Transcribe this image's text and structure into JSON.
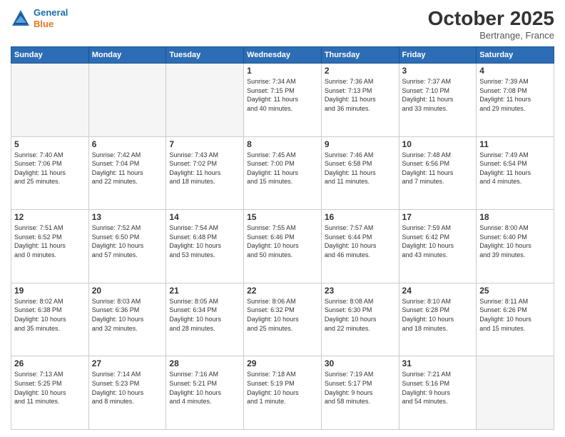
{
  "header": {
    "logo_line1": "General",
    "logo_line2": "Blue",
    "month": "October 2025",
    "location": "Bertrange, France"
  },
  "weekdays": [
    "Sunday",
    "Monday",
    "Tuesday",
    "Wednesday",
    "Thursday",
    "Friday",
    "Saturday"
  ],
  "weeks": [
    [
      {
        "day": "",
        "info": ""
      },
      {
        "day": "",
        "info": ""
      },
      {
        "day": "",
        "info": ""
      },
      {
        "day": "1",
        "info": "Sunrise: 7:34 AM\nSunset: 7:15 PM\nDaylight: 11 hours\nand 40 minutes."
      },
      {
        "day": "2",
        "info": "Sunrise: 7:36 AM\nSunset: 7:13 PM\nDaylight: 11 hours\nand 36 minutes."
      },
      {
        "day": "3",
        "info": "Sunrise: 7:37 AM\nSunset: 7:10 PM\nDaylight: 11 hours\nand 33 minutes."
      },
      {
        "day": "4",
        "info": "Sunrise: 7:39 AM\nSunset: 7:08 PM\nDaylight: 11 hours\nand 29 minutes."
      }
    ],
    [
      {
        "day": "5",
        "info": "Sunrise: 7:40 AM\nSunset: 7:06 PM\nDaylight: 11 hours\nand 25 minutes."
      },
      {
        "day": "6",
        "info": "Sunrise: 7:42 AM\nSunset: 7:04 PM\nDaylight: 11 hours\nand 22 minutes."
      },
      {
        "day": "7",
        "info": "Sunrise: 7:43 AM\nSunset: 7:02 PM\nDaylight: 11 hours\nand 18 minutes."
      },
      {
        "day": "8",
        "info": "Sunrise: 7:45 AM\nSunset: 7:00 PM\nDaylight: 11 hours\nand 15 minutes."
      },
      {
        "day": "9",
        "info": "Sunrise: 7:46 AM\nSunset: 6:58 PM\nDaylight: 11 hours\nand 11 minutes."
      },
      {
        "day": "10",
        "info": "Sunrise: 7:48 AM\nSunset: 6:56 PM\nDaylight: 11 hours\nand 7 minutes."
      },
      {
        "day": "11",
        "info": "Sunrise: 7:49 AM\nSunset: 6:54 PM\nDaylight: 11 hours\nand 4 minutes."
      }
    ],
    [
      {
        "day": "12",
        "info": "Sunrise: 7:51 AM\nSunset: 6:52 PM\nDaylight: 11 hours\nand 0 minutes."
      },
      {
        "day": "13",
        "info": "Sunrise: 7:52 AM\nSunset: 6:50 PM\nDaylight: 10 hours\nand 57 minutes."
      },
      {
        "day": "14",
        "info": "Sunrise: 7:54 AM\nSunset: 6:48 PM\nDaylight: 10 hours\nand 53 minutes."
      },
      {
        "day": "15",
        "info": "Sunrise: 7:55 AM\nSunset: 6:46 PM\nDaylight: 10 hours\nand 50 minutes."
      },
      {
        "day": "16",
        "info": "Sunrise: 7:57 AM\nSunset: 6:44 PM\nDaylight: 10 hours\nand 46 minutes."
      },
      {
        "day": "17",
        "info": "Sunrise: 7:59 AM\nSunset: 6:42 PM\nDaylight: 10 hours\nand 43 minutes."
      },
      {
        "day": "18",
        "info": "Sunrise: 8:00 AM\nSunset: 6:40 PM\nDaylight: 10 hours\nand 39 minutes."
      }
    ],
    [
      {
        "day": "19",
        "info": "Sunrise: 8:02 AM\nSunset: 6:38 PM\nDaylight: 10 hours\nand 35 minutes."
      },
      {
        "day": "20",
        "info": "Sunrise: 8:03 AM\nSunset: 6:36 PM\nDaylight: 10 hours\nand 32 minutes."
      },
      {
        "day": "21",
        "info": "Sunrise: 8:05 AM\nSunset: 6:34 PM\nDaylight: 10 hours\nand 28 minutes."
      },
      {
        "day": "22",
        "info": "Sunrise: 8:06 AM\nSunset: 6:32 PM\nDaylight: 10 hours\nand 25 minutes."
      },
      {
        "day": "23",
        "info": "Sunrise: 8:08 AM\nSunset: 6:30 PM\nDaylight: 10 hours\nand 22 minutes."
      },
      {
        "day": "24",
        "info": "Sunrise: 8:10 AM\nSunset: 6:28 PM\nDaylight: 10 hours\nand 18 minutes."
      },
      {
        "day": "25",
        "info": "Sunrise: 8:11 AM\nSunset: 6:26 PM\nDaylight: 10 hours\nand 15 minutes."
      }
    ],
    [
      {
        "day": "26",
        "info": "Sunrise: 7:13 AM\nSunset: 5:25 PM\nDaylight: 10 hours\nand 11 minutes."
      },
      {
        "day": "27",
        "info": "Sunrise: 7:14 AM\nSunset: 5:23 PM\nDaylight: 10 hours\nand 8 minutes."
      },
      {
        "day": "28",
        "info": "Sunrise: 7:16 AM\nSunset: 5:21 PM\nDaylight: 10 hours\nand 4 minutes."
      },
      {
        "day": "29",
        "info": "Sunrise: 7:18 AM\nSunset: 5:19 PM\nDaylight: 10 hours\nand 1 minute."
      },
      {
        "day": "30",
        "info": "Sunrise: 7:19 AM\nSunset: 5:17 PM\nDaylight: 9 hours\nand 58 minutes."
      },
      {
        "day": "31",
        "info": "Sunrise: 7:21 AM\nSunset: 5:16 PM\nDaylight: 9 hours\nand 54 minutes."
      },
      {
        "day": "",
        "info": ""
      }
    ]
  ]
}
